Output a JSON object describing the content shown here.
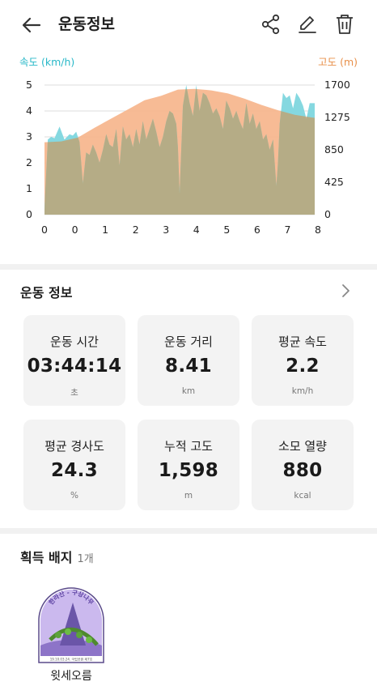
{
  "header": {
    "title": "운동정보",
    "back_icon": "arrow-left-icon",
    "actions": [
      "share-icon",
      "edit-icon",
      "trash-icon"
    ]
  },
  "chart_data": {
    "type": "area",
    "left_axis_label": "속도 (km/h)",
    "right_axis_label": "고도 (m)",
    "x_ticks": [
      "0",
      "0",
      "1",
      "2",
      "3",
      "4",
      "5",
      "6",
      "7",
      "8"
    ],
    "y_left_ticks": [
      "5",
      "4",
      "3",
      "2",
      "1",
      "0"
    ],
    "y_right_ticks": [
      "1700",
      "1275",
      "850",
      "425",
      "0"
    ],
    "y_left_range": [
      0,
      5
    ],
    "y_right_range": [
      0,
      1700
    ],
    "grid": true,
    "colors": {
      "speed": "#7ED6DE",
      "altitude": "#F6B48A",
      "overlap": "#B5AC86",
      "left_axis": "#28B8C8",
      "right_axis": "#E8904A"
    },
    "series": [
      {
        "name": "속도 (km/h)",
        "axis": "left",
        "x": [
          0.0,
          0.1,
          0.2,
          0.3,
          0.45,
          0.6,
          0.75,
          0.85,
          0.95,
          1.05,
          1.15,
          1.25,
          1.35,
          1.45,
          1.55,
          1.65,
          1.75,
          1.85,
          1.95,
          2.05,
          2.15,
          2.25,
          2.35,
          2.45,
          2.55,
          2.65,
          2.75,
          2.85,
          2.95,
          3.05,
          3.15,
          3.25,
          3.35,
          3.45,
          3.55,
          3.65,
          3.75,
          3.85,
          3.95,
          4.0,
          4.05,
          4.15,
          4.25,
          4.35,
          4.45,
          4.55,
          4.65,
          4.75,
          4.85,
          4.95,
          5.05,
          5.15,
          5.25,
          5.35,
          5.45,
          5.55,
          5.65,
          5.75,
          5.85,
          5.95,
          6.05,
          6.15,
          6.25,
          6.35,
          6.45,
          6.55,
          6.65,
          6.75,
          6.85,
          6.95,
          7.0,
          7.05,
          7.15,
          7.25,
          7.35,
          7.45,
          7.55,
          7.65,
          7.75,
          7.85,
          7.95,
          8.1
        ],
        "values": [
          0.2,
          2.9,
          3.0,
          2.95,
          3.4,
          2.9,
          3.1,
          3.05,
          3.2,
          2.8,
          1.2,
          2.4,
          2.3,
          2.7,
          2.4,
          2.0,
          2.5,
          3.1,
          2.7,
          2.6,
          3.3,
          1.9,
          3.4,
          2.9,
          3.1,
          2.6,
          3.3,
          2.7,
          3.6,
          2.9,
          3.3,
          3.7,
          3.2,
          2.6,
          3.0,
          3.6,
          4.0,
          3.9,
          3.5,
          2.6,
          0.8,
          4.2,
          5.0,
          4.3,
          3.8,
          5.0,
          4.0,
          4.7,
          4.6,
          4.3,
          3.9,
          4.1,
          3.8,
          3.3,
          4.4,
          4.1,
          3.7,
          4.0,
          3.6,
          3.3,
          4.3,
          3.5,
          3.9,
          3.3,
          3.6,
          2.9,
          3.1,
          2.5,
          2.9,
          1.1,
          2.0,
          3.5,
          4.7,
          4.5,
          4.6,
          4.1,
          4.7,
          4.5,
          4.2,
          3.7,
          4.3,
          4.3
        ]
      },
      {
        "name": "고도 (m)",
        "axis": "right",
        "x": [
          0.0,
          0.5,
          1.0,
          1.5,
          2.0,
          2.5,
          3.0,
          3.5,
          4.0,
          4.5,
          5.0,
          5.5,
          6.0,
          6.5,
          7.0,
          7.5,
          8.0,
          8.1
        ],
        "values": [
          950,
          960,
          1010,
          1140,
          1260,
          1380,
          1500,
          1560,
          1640,
          1650,
          1630,
          1590,
          1520,
          1440,
          1370,
          1310,
          1275,
          1270
        ]
      }
    ]
  },
  "exercise_info": {
    "title": "운동 정보",
    "more_icon": "chevron-right-icon",
    "stats": [
      {
        "label": "운동 시간",
        "value": "03:44:14",
        "unit": "초"
      },
      {
        "label": "운동 거리",
        "value": "8.41",
        "unit": "km"
      },
      {
        "label": "평균 속도",
        "value": "2.2",
        "unit": "km/h"
      },
      {
        "label": "평균 경사도",
        "value": "24.3",
        "unit": "%"
      },
      {
        "label": "누적 고도",
        "value": "1,598",
        "unit": "m"
      },
      {
        "label": "소모 열량",
        "value": "880",
        "unit": "kcal"
      }
    ]
  },
  "badges": {
    "title": "획득 배지",
    "count": "1개",
    "items": [
      {
        "name": "윗세오름",
        "arc_text": "한라산 - 구상나무",
        "fine_print": "19.10.03.24. 국립공원 제7호"
      }
    ]
  }
}
